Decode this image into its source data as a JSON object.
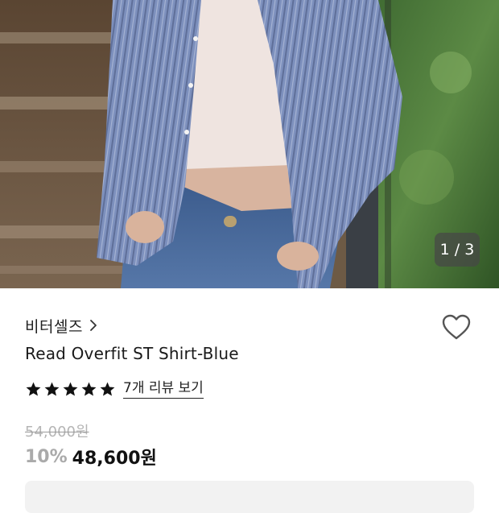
{
  "gallery": {
    "page_indicator": "1 / 3"
  },
  "product": {
    "brand": "비터셀즈",
    "title": "Read Overfit ST Shirt-Blue",
    "rating": 5,
    "review_link": "7개 리뷰 보기",
    "original_price": "54,000원",
    "discount": "10%",
    "sale_price": "48,600원"
  },
  "icons": {
    "brand_chevron": "chevron-right-icon",
    "wishlist": "heart-outline-icon",
    "star": "star-filled-icon"
  },
  "colors": {
    "star": "#111111",
    "discount": "#aaaaaa",
    "original_price": "#b5b5b5",
    "indicator_bg": "#464646"
  }
}
